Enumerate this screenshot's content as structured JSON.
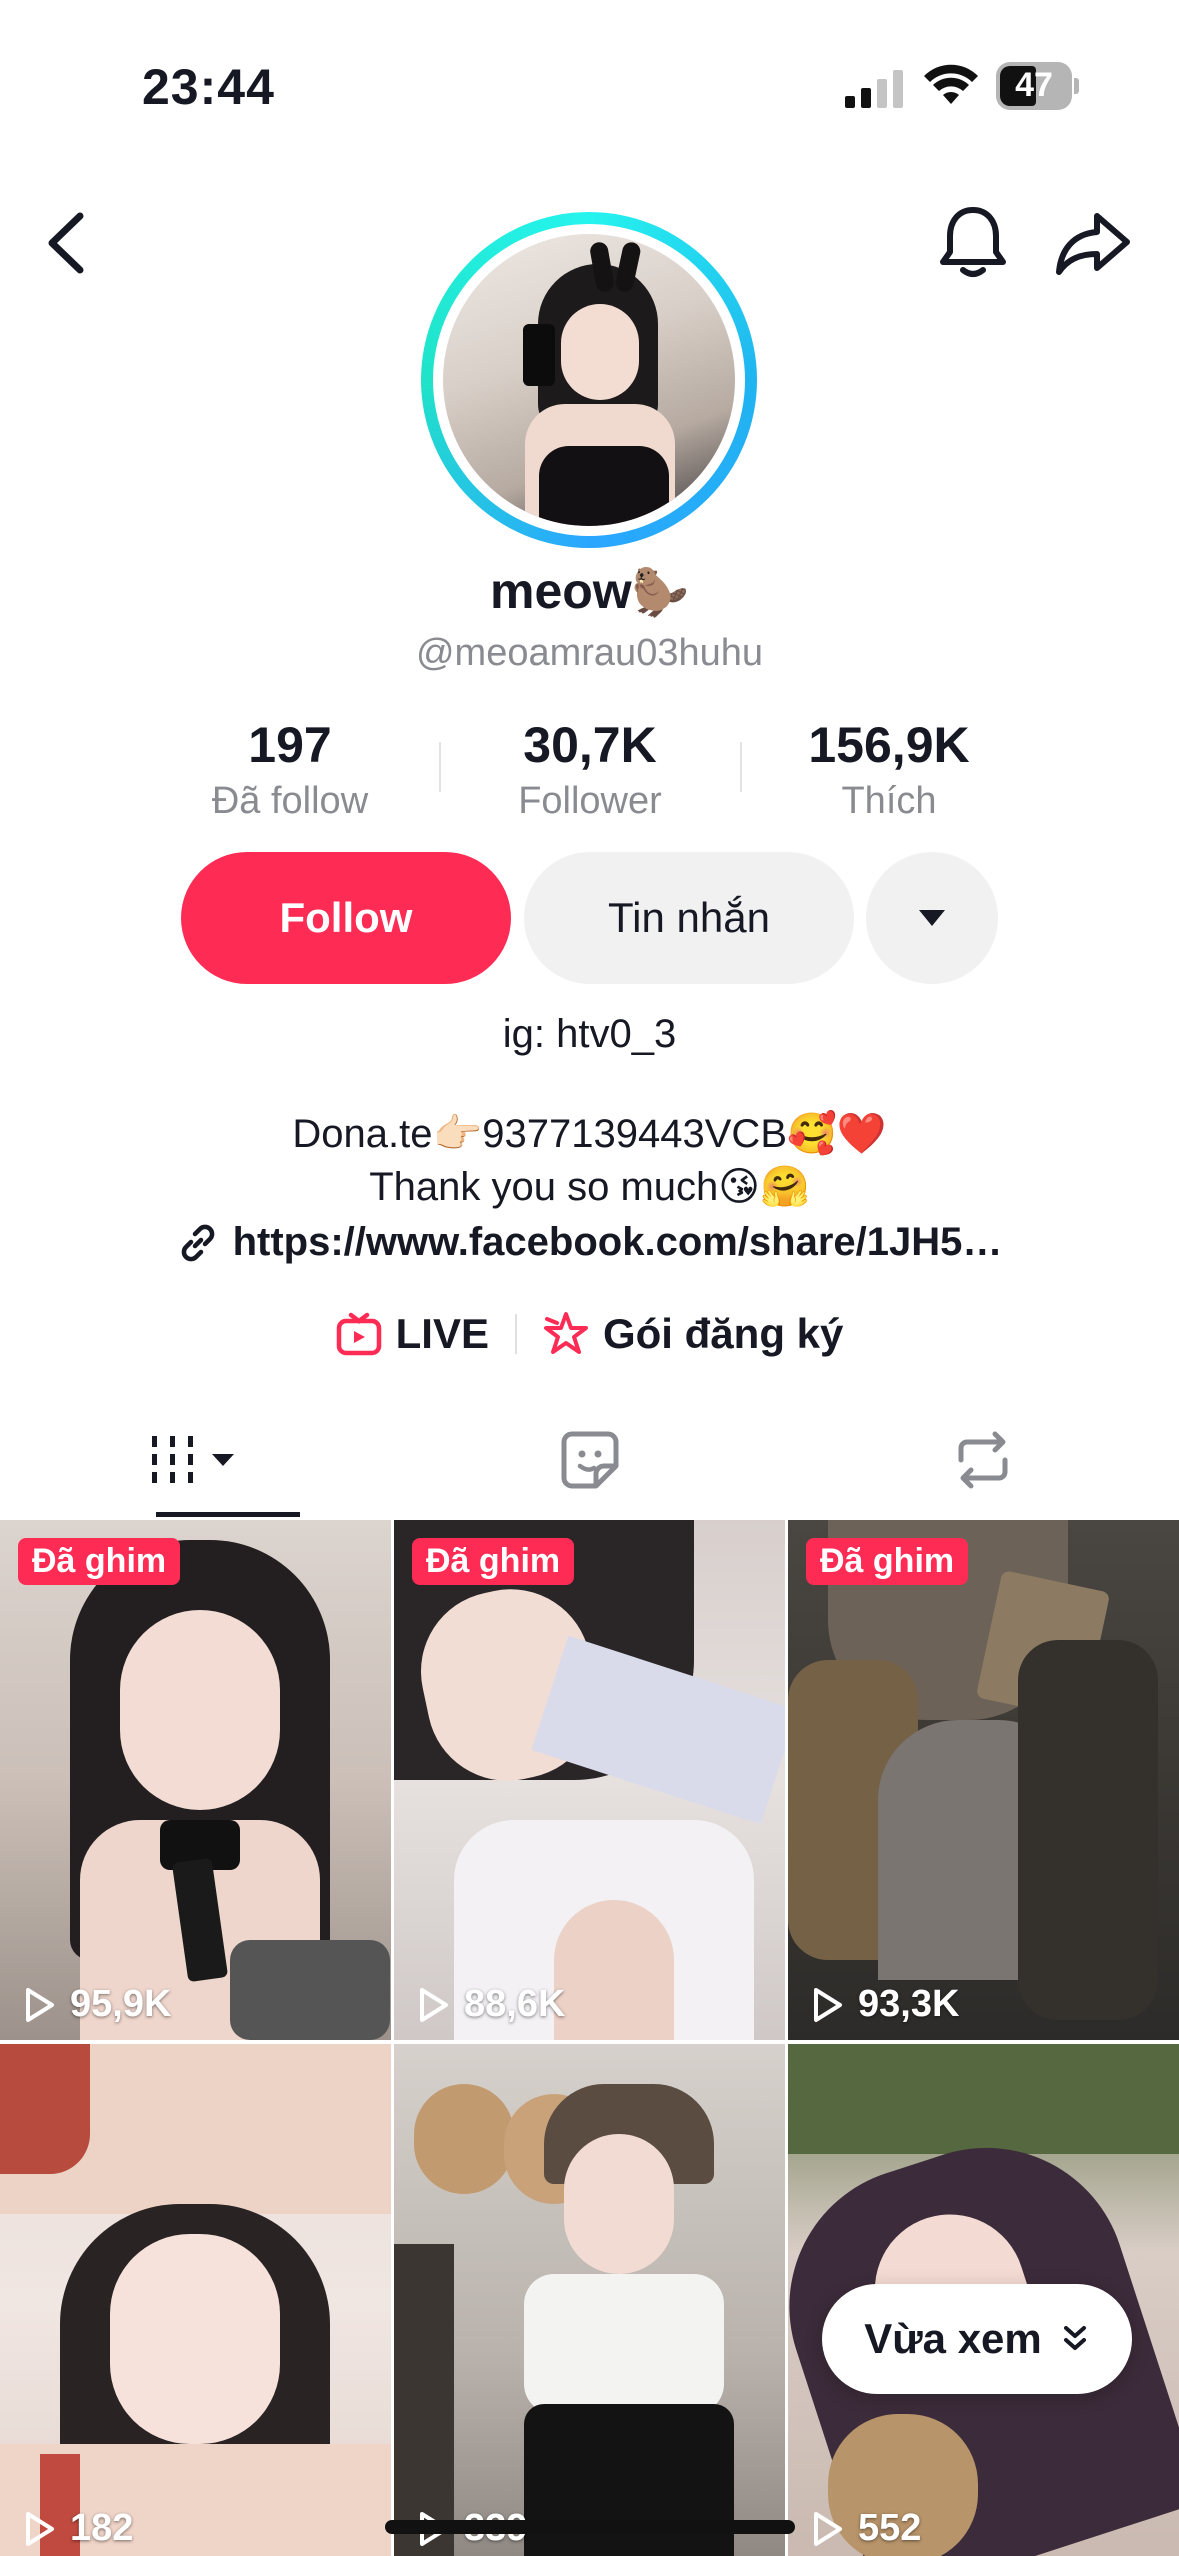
{
  "status_bar": {
    "time": "23:44",
    "battery": "47"
  },
  "profile": {
    "display_name": "meow",
    "name_emoji": "🦫",
    "handle": "@meoamrau03huhu",
    "stats": [
      {
        "value": "197",
        "label": "Đã follow"
      },
      {
        "value": "30,7K",
        "label": "Follower"
      },
      {
        "value": "156,9K",
        "label": "Thích"
      }
    ],
    "buttons": {
      "follow": "Follow",
      "message": "Tin nhắn"
    },
    "ig_line": "ig: htv0_3",
    "bio_line1": "Dona.te👉🏻9377139443VCB🥰❤️",
    "bio_line2": "Thank you so much😘🤗",
    "link": "https://www.facebook.com/share/1JH5…",
    "features": {
      "live": "LIVE",
      "subscription": "Gói đăng ký"
    }
  },
  "videos": [
    {
      "pinned": "Đã ghim",
      "views": "95,9K"
    },
    {
      "pinned": "Đã ghim",
      "views": "88,6K"
    },
    {
      "pinned": "Đã ghim",
      "views": "93,3K"
    },
    {
      "views": "182"
    },
    {
      "views": "339"
    },
    {
      "views": "552"
    }
  ],
  "recent_pill": "Vừa xem",
  "colors": {
    "accent": "#fe2c55",
    "ring": "#25f4ee",
    "text": "#161823",
    "muted": "#8a8b91"
  }
}
